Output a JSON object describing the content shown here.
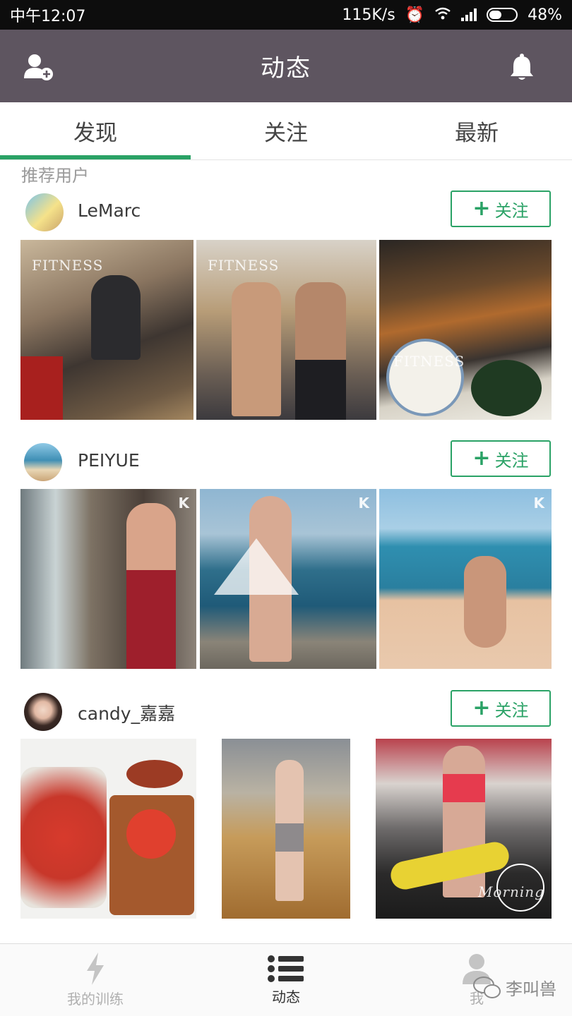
{
  "status_bar": {
    "time": "中午12:07",
    "speed": "115K/s",
    "battery": "48%",
    "battery_level": 0.48
  },
  "header": {
    "title": "动态",
    "left_icon": "add-user-icon",
    "right_icon": "bell-icon"
  },
  "tabs": [
    {
      "label": "发现",
      "active": true
    },
    {
      "label": "关注",
      "active": false
    },
    {
      "label": "最新",
      "active": false
    }
  ],
  "section_title": "推荐用户",
  "users": [
    {
      "name": "LeMarc",
      "follow_label": "关注",
      "photos": [
        "gym-machine-photo",
        "fitness-duo-photo",
        "skewer-dinner-photo"
      ],
      "photo_tags": [
        "FITNESS",
        "FITNESS",
        "FITNESS"
      ]
    },
    {
      "name": "PEIYUE",
      "follow_label": "关注",
      "photos": [
        "mirror-selfie-photo",
        "beach-fringe-photo",
        "beach-sitting-photo"
      ]
    },
    {
      "name": "candy_嘉嘉",
      "follow_label": "关注",
      "photos": [
        "tomato-breakfast-photo",
        "dance-studio-photo",
        "spin-class-photo"
      ],
      "photo_tags": [
        "",
        "",
        "Morning"
      ]
    }
  ],
  "bottom_nav": [
    {
      "label": "我的训练",
      "icon": "lightning-icon",
      "active": false
    },
    {
      "label": "动态",
      "icon": "list-icon",
      "active": true
    },
    {
      "label": "我",
      "icon": "person-icon",
      "active": false
    }
  ],
  "watermark": "李叫兽"
}
